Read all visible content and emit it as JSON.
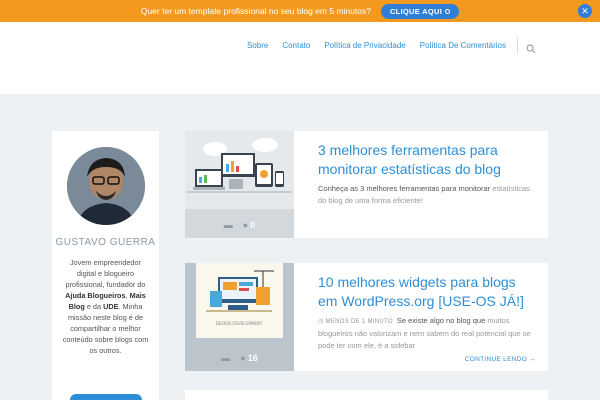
{
  "promo": {
    "text": "Quer ter um template profissional no seu blog em 5 minutos?",
    "button_label": "CLIQUE AQUI",
    "close_glyph": "✕"
  },
  "nav": {
    "items": [
      "Sobre",
      "Contato",
      "Política de Privacidade",
      "Política De Comentários"
    ],
    "search_icon": "search-icon"
  },
  "author": {
    "name": "GUSTAVO GUERRA",
    "bio_1": "Jovem empreendedor digital e blogueiro profissional, fundador do ",
    "bio_link1": "Ajuda Blogueiros",
    "bio_2": ", ",
    "bio_link2": "Mais Blog",
    "bio_3": " e da ",
    "bio_link3": "UDE",
    "bio_4": ". Minha missão neste blog é de compartilhar o melhor conteúdo sobre blogs com os outros."
  },
  "posts": [
    {
      "title": "3 melhores ferramentas para monitorar estatísticas do blog",
      "excerpt": "Conheça as 3 melhores ferramentas para monitorar",
      "excerpt_faded": "estatísticas do blog de uma forma eficiente!",
      "comments": "0"
    },
    {
      "title": "10 melhores widgets para blogs em WordPress.org [USE-OS JÁ!]",
      "meta": "MENOS DE 1 MINUTO",
      "excerpt": "Se existe algo no blog que",
      "excerpt_faded": "muitos blogueiros não valorizam e nem sabem do real potencial que se pode ter com ele, é a sidebar",
      "comments": "16",
      "read_more": "CONTINUE LENDO →",
      "thumb_caption": "DESIGN DEVELOPMENT"
    }
  ],
  "colors": {
    "promo_bg": "#f39a1e",
    "accent": "#2f8fd6",
    "page_bg": "#eef1f3"
  }
}
